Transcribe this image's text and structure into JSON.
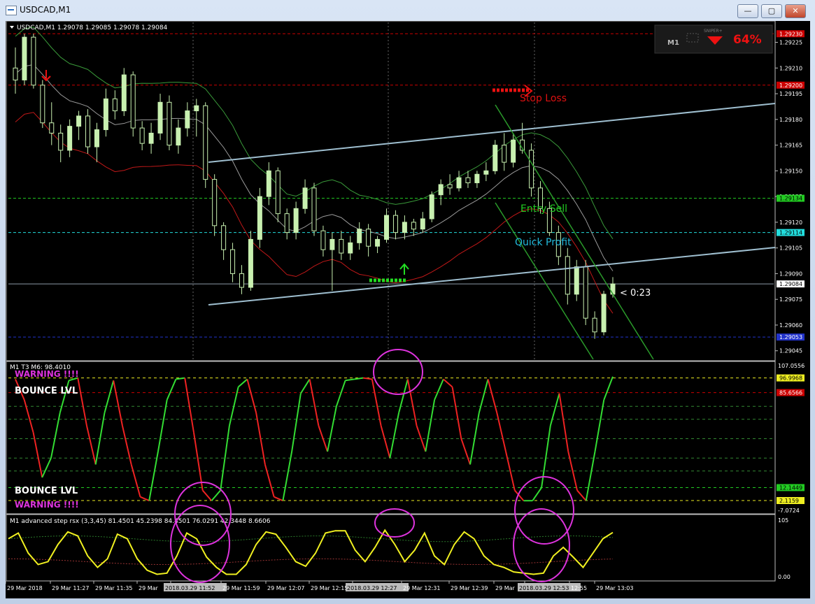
{
  "window": {
    "title": "USDCAD,M1",
    "minimize_label": "—",
    "maximize_label": "▢",
    "close_label": "✕"
  },
  "colors": {
    "background": "#000000",
    "bull_candle": "#c8f0b0",
    "bear_candle": "#000000",
    "upper_band": "#3a9a3a",
    "middle_band": "#9a9a9a",
    "lower_band": "#c01818",
    "channel_line": "#9fbfd0",
    "down_channel": "#2a9a2a",
    "rsi_green": "#33dd33",
    "rsi_red": "#ee2222",
    "step_rsx": "#f0f020",
    "annotation_circle": "#dd33dd"
  },
  "main_header": "USDCAD,M1  1.29078 1.29085 1.29078 1.29084",
  "signal_widget": {
    "timeframe": "M1",
    "percent": "64%",
    "brand": "SNIPER+"
  },
  "annotations": {
    "stop_loss": "Stop Loss",
    "entry_sell": "Entry Sell",
    "quick_profit": "Quick Profit",
    "countdown": "< 0:23"
  },
  "price_axis": {
    "ticks": [
      "1.29225",
      "1.29210",
      "1.29195",
      "1.29180",
      "1.29165",
      "1.29150",
      "1.29135",
      "1.29120",
      "1.29105",
      "1.29090",
      "1.29075",
      "1.29060",
      "1.29045"
    ],
    "badges": [
      {
        "label": "1.29230",
        "value": 1.2923,
        "color": "#cc0000",
        "text_color": "#ffffff"
      },
      {
        "label": "1.29200",
        "value": 1.292,
        "color": "#cc0000",
        "text_color": "#ffffff"
      },
      {
        "label": "1.29134",
        "value": 1.29134,
        "color": "#22cc22",
        "text_color": "#000000"
      },
      {
        "label": "1.29114",
        "value": 1.29114,
        "color": "#22dddd",
        "text_color": "#000000"
      },
      {
        "label": "1.29084",
        "value": 1.29084,
        "color": "#ffffff",
        "text_color": "#000000"
      },
      {
        "label": "1.29053",
        "value": 1.29053,
        "color": "#2233cc",
        "text_color": "#ffffff"
      }
    ]
  },
  "rsi_panel": {
    "header": "M1 T3 M6: 98.4010",
    "warning_label": "WARNING !!!!",
    "bounce_label": "BOUNCE LVL",
    "axis_ticks": [
      "107.0556",
      "-7.0724"
    ],
    "badges": [
      {
        "label": "96.9968",
        "value": 96.9968,
        "color": "#eeee22",
        "text_color": "#000000"
      },
      {
        "label": "85.6566",
        "value": 85.6566,
        "color": "#cc0000",
        "text_color": "#ffffff"
      },
      {
        "label": "12.1449",
        "value": 12.1449,
        "color": "#22cc22",
        "text_color": "#000000"
      },
      {
        "label": "2.1159",
        "value": 2.1159,
        "color": "#eeee22",
        "text_color": "#000000"
      }
    ],
    "levels": [
      96.9968,
      85.6566,
      75,
      65,
      50,
      35,
      25,
      12.1449,
      2.1159
    ]
  },
  "rsx_panel": {
    "header": "M1 advanced step rsx (3,3,45) 81.4501 45.2398 84.4501 76.0291 42.3448 8.6606",
    "axis_ticks": [
      "105",
      "0.00"
    ]
  },
  "time_axis": {
    "labels": [
      "29 Mar 2018",
      "29 Mar 11:27",
      "29 Mar 11:35",
      "29 Mar",
      "2018.03.29 11:52",
      "29 Mar 11:59",
      "29 Mar 12:07",
      "29 Mar 12:15",
      "2018.03.29 12:27",
      "29 Mar 12:31",
      "29 Mar 12:39",
      "29 Mar",
      "2018.03.29 12:53",
      "12:55",
      "29 Mar 13:03"
    ],
    "highlighted": [
      false,
      false,
      false,
      false,
      true,
      false,
      false,
      false,
      true,
      false,
      false,
      false,
      true,
      false,
      false
    ]
  },
  "chart_data": [
    {
      "type": "candlestick",
      "title": "USDCAD,M1",
      "ylim": [
        1.2904,
        1.29235
      ],
      "ohlc_note": "approximate",
      "candles": [
        [
          1.2921,
          1.29222,
          1.29195,
          1.29203
        ],
        [
          1.29203,
          1.2923,
          1.292,
          1.29228
        ],
        [
          1.29228,
          1.2923,
          1.29198,
          1.292
        ],
        [
          1.292,
          1.29203,
          1.29175,
          1.29178
        ],
        [
          1.29178,
          1.2919,
          1.29165,
          1.29172
        ],
        [
          1.29172,
          1.29177,
          1.29155,
          1.29162
        ],
        [
          1.29162,
          1.2918,
          1.29158,
          1.29176
        ],
        [
          1.29176,
          1.29185,
          1.29168,
          1.29182
        ],
        [
          1.29182,
          1.29186,
          1.2916,
          1.29164
        ],
        [
          1.29164,
          1.29178,
          1.29155,
          1.29174
        ],
        [
          1.29174,
          1.29198,
          1.2917,
          1.29192
        ],
        [
          1.29192,
          1.29197,
          1.2918,
          1.29185
        ],
        [
          1.29185,
          1.2921,
          1.29182,
          1.29206
        ],
        [
          1.29206,
          1.29208,
          1.2917,
          1.29175
        ],
        [
          1.29175,
          1.29179,
          1.29162,
          1.29166
        ],
        [
          1.29166,
          1.29178,
          1.2916,
          1.29172
        ],
        [
          1.29172,
          1.29195,
          1.29168,
          1.2919
        ],
        [
          1.2919,
          1.29194,
          1.29162,
          1.29165
        ],
        [
          1.29165,
          1.2918,
          1.2916,
          1.29175
        ],
        [
          1.29175,
          1.2919,
          1.2917,
          1.29185
        ],
        [
          1.29185,
          1.29192,
          1.2917,
          1.29188
        ],
        [
          1.29188,
          1.2919,
          1.2914,
          1.29145
        ],
        [
          1.29145,
          1.29148,
          1.29112,
          1.29118
        ],
        [
          1.29118,
          1.2912,
          1.29098,
          1.29104
        ],
        [
          1.29104,
          1.29108,
          1.29085,
          1.2909
        ],
        [
          1.2909,
          1.29095,
          1.29078,
          1.29082
        ],
        [
          1.29082,
          1.29115,
          1.2908,
          1.2911
        ],
        [
          1.2911,
          1.2914,
          1.29105,
          1.29135
        ],
        [
          1.29135,
          1.29155,
          1.2913,
          1.2915
        ],
        [
          1.2915,
          1.29152,
          1.2912,
          1.29125
        ],
        [
          1.29125,
          1.29128,
          1.2911,
          1.29114
        ],
        [
          1.29114,
          1.29132,
          1.2911,
          1.29128
        ],
        [
          1.29128,
          1.29145,
          1.29125,
          1.2914
        ],
        [
          1.2914,
          1.29143,
          1.29112,
          1.29115
        ],
        [
          1.29115,
          1.29118,
          1.291,
          1.29104
        ],
        [
          1.29104,
          1.29114,
          1.2908,
          1.2911
        ],
        [
          1.2911,
          1.29115,
          1.29098,
          1.29102
        ],
        [
          1.29102,
          1.29112,
          1.29098,
          1.29108
        ],
        [
          1.29108,
          1.2912,
          1.29104,
          1.29116
        ],
        [
          1.29116,
          1.29119,
          1.291,
          1.29106
        ],
        [
          1.29106,
          1.29112,
          1.29102,
          1.2911
        ],
        [
          1.2911,
          1.29128,
          1.29108,
          1.29124
        ],
        [
          1.29124,
          1.29127,
          1.2911,
          1.29114
        ],
        [
          1.29114,
          1.29124,
          1.2911,
          1.2912
        ],
        [
          1.2912,
          1.29122,
          1.29112,
          1.29116
        ],
        [
          1.29116,
          1.29126,
          1.29114,
          1.29122
        ],
        [
          1.29122,
          1.29138,
          1.2912,
          1.29136
        ],
        [
          1.29136,
          1.29145,
          1.2913,
          1.29142
        ],
        [
          1.29142,
          1.29148,
          1.29136,
          1.2914
        ],
        [
          1.2914,
          1.2915,
          1.29138,
          1.29146
        ],
        [
          1.29146,
          1.2915,
          1.2914,
          1.29143
        ],
        [
          1.29143,
          1.2915,
          1.2914,
          1.29148
        ],
        [
          1.29148,
          1.29155,
          1.29144,
          1.2915
        ],
        [
          1.2915,
          1.29168,
          1.29148,
          1.29165
        ],
        [
          1.29165,
          1.29172,
          1.2915,
          1.29155
        ],
        [
          1.29155,
          1.29172,
          1.29152,
          1.29168
        ],
        [
          1.29168,
          1.29178,
          1.2916,
          1.29162
        ],
        [
          1.29162,
          1.29166,
          1.29135,
          1.2914
        ],
        [
          1.2914,
          1.29144,
          1.29125,
          1.29128
        ],
        [
          1.29128,
          1.29132,
          1.29112,
          1.29114
        ],
        [
          1.29114,
          1.29118,
          1.29095,
          1.291
        ],
        [
          1.291,
          1.29105,
          1.29072,
          1.29078
        ],
        [
          1.29078,
          1.29098,
          1.29074,
          1.29094
        ],
        [
          1.29094,
          1.29098,
          1.2906,
          1.29064
        ],
        [
          1.29064,
          1.29068,
          1.29052,
          1.29056
        ],
        [
          1.29056,
          1.2908,
          1.29054,
          1.29078
        ],
        [
          1.29078,
          1.29088,
          1.29076,
          1.29084
        ]
      ]
    },
    {
      "type": "line",
      "title": "M1 T3 M6: 98.4010",
      "ylim": [
        -7.0724,
        107.0556
      ],
      "series": [
        {
          "values": [
            96,
            80,
            55,
            20,
            35,
            70,
            95,
            97,
            60,
            30,
            70,
            95,
            60,
            30,
            5,
            2,
            40,
            80,
            96,
            97,
            55,
            10,
            2,
            10,
            60,
            90,
            96,
            70,
            30,
            5,
            2,
            40,
            85,
            96,
            60,
            40,
            75,
            95,
            96,
            97,
            96,
            60,
            35,
            70,
            96,
            60,
            40,
            80,
            96,
            90,
            50,
            30,
            70,
            96,
            70,
            40,
            10,
            2,
            2,
            12,
            60,
            85,
            40,
            10,
            2,
            40,
            80,
            98
          ]
        }
      ]
    },
    {
      "type": "line",
      "title": "M1 advanced step rsx (3,3,45)",
      "ylim": [
        0,
        105
      ],
      "series": [
        {
          "values": [
            70,
            80,
            45,
            25,
            30,
            60,
            82,
            75,
            40,
            20,
            35,
            78,
            70,
            35,
            15,
            8,
            10,
            40,
            80,
            70,
            38,
            20,
            8,
            8,
            25,
            60,
            82,
            78,
            55,
            30,
            22,
            45,
            80,
            84,
            84,
            50,
            30,
            55,
            85,
            60,
            30,
            50,
            80,
            40,
            25,
            60,
            82,
            70,
            40,
            25,
            20,
            12,
            10,
            8,
            10,
            40,
            55,
            38,
            20,
            45,
            70,
            81
          ]
        }
      ]
    }
  ]
}
